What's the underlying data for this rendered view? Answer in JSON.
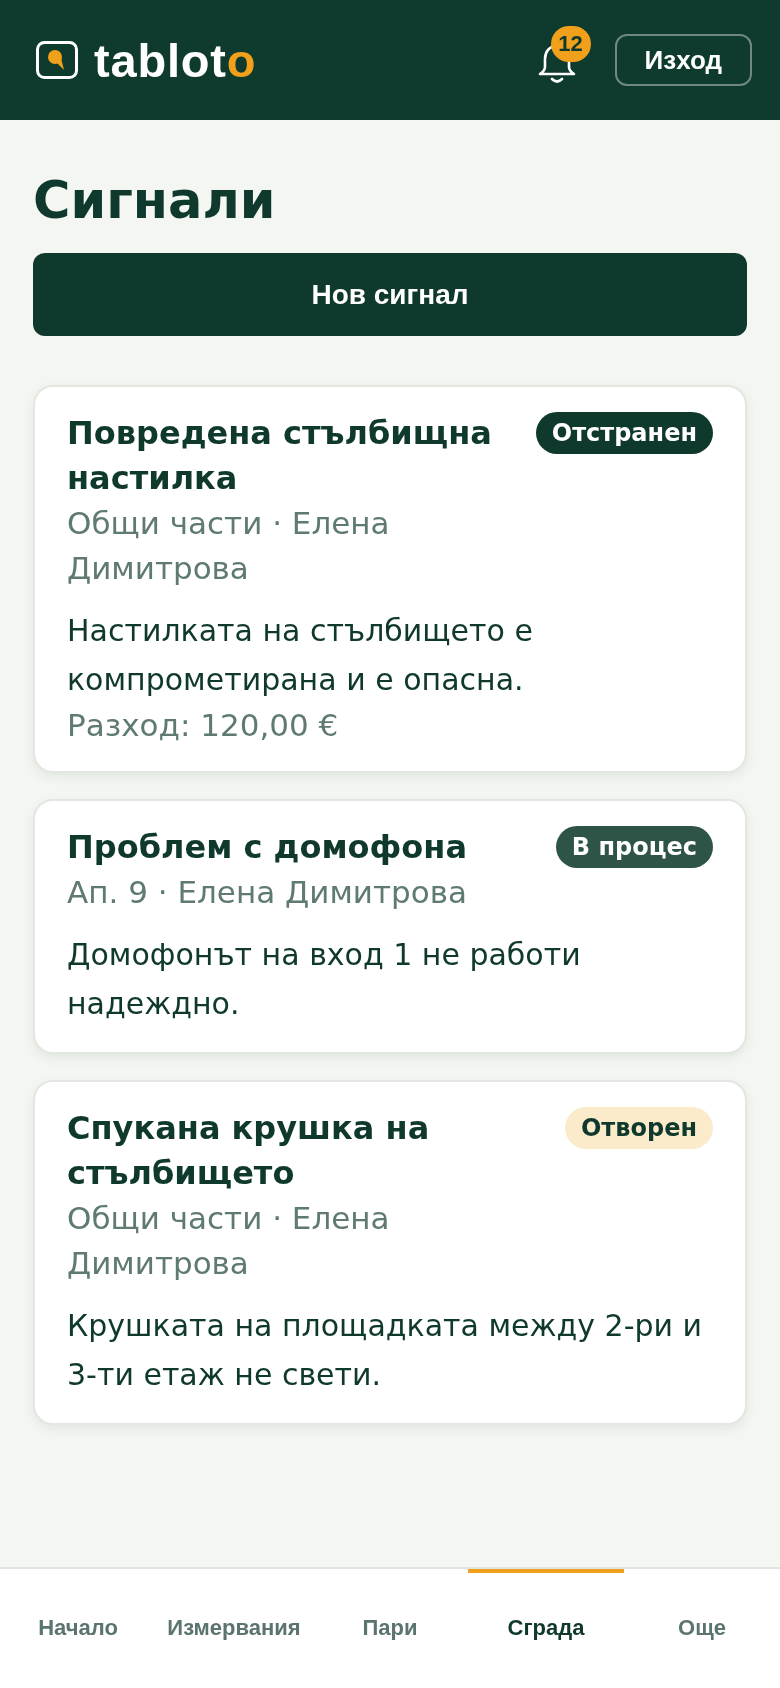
{
  "header": {
    "brand": {
      "name": "tablot",
      "accent": "o"
    },
    "notifications": {
      "count": "12"
    },
    "logout_button": "Изход"
  },
  "page": {
    "title": "Сигнали",
    "new_button": "Нов сигнал"
  },
  "signals": [
    {
      "title": "Повредена стълбищна настилка",
      "status": {
        "label": "Отстранен",
        "kind": "resolved"
      },
      "meta": "Общи части · Елена Димитрова",
      "description": "Настилката на стълбището е компрометирана и е опасна.",
      "expense": "Разход: 120,00 €"
    },
    {
      "title": "Проблем с домофона",
      "status": {
        "label": "В процес",
        "kind": "in_progress"
      },
      "meta": "Ап. 9 · Елена Димитрова",
      "description": "Домофонът на вход 1 не работи надеждно."
    },
    {
      "title": "Спукана крушка на стълбището",
      "status": {
        "label": "Отворен",
        "kind": "open"
      },
      "meta": "Общи части · Елена Димитрова",
      "description": "Крушката на площадката между 2-ри и 3-ти етаж не свети."
    }
  ],
  "bottom_nav": [
    {
      "label": "Начало",
      "selected": false
    },
    {
      "label": "Измервания",
      "selected": false
    },
    {
      "label": "Пари",
      "selected": false
    },
    {
      "label": "Сграда",
      "selected": true
    },
    {
      "label": "Още",
      "selected": false
    }
  ]
}
